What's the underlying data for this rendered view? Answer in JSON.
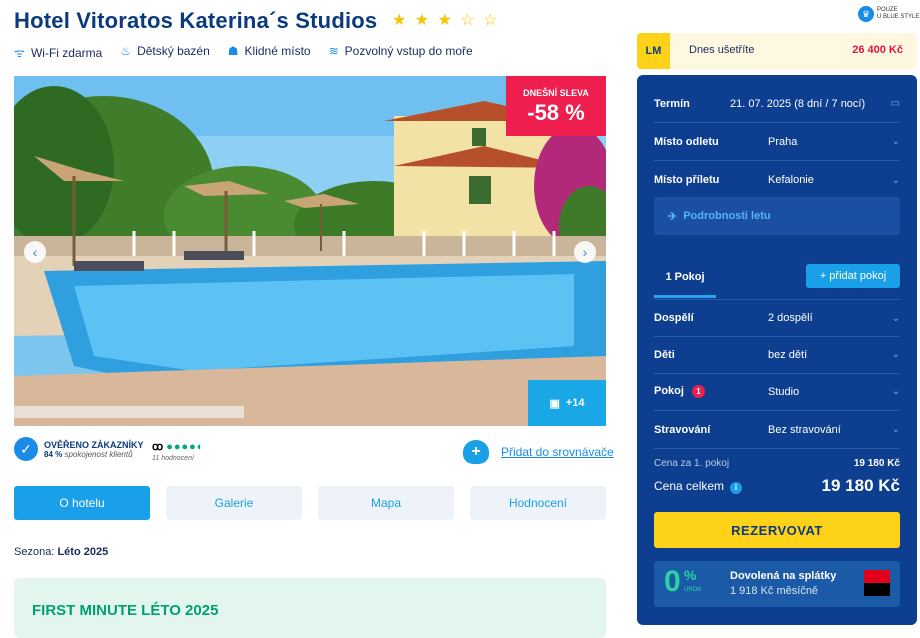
{
  "hotel": {
    "name": "Hotel Vitoratos Katerina´s Studios",
    "stars_filled": "★ ★ ★",
    "stars_empty": "☆ ☆"
  },
  "badge": {
    "line1": "POUZE",
    "line2": "U BLUE STYLE",
    "icon": "crown-icon"
  },
  "amenities": [
    {
      "icon": "wifi-icon",
      "label": "Wi-Fi zdarma"
    },
    {
      "icon": "pool-icon",
      "label": "Dětský bazén"
    },
    {
      "icon": "quiet-icon",
      "label": "Klidné místo"
    },
    {
      "icon": "beach-icon",
      "label": "Pozvolný vstup do moře"
    }
  ],
  "photo": {
    "sale_label": "DNEŠNÍ SLEVA",
    "sale_value": "-58 %",
    "gallery_count": "+14"
  },
  "verified": {
    "title": "OVĚŘENO ZÁKAZNÍKY",
    "percent": "84 %",
    "text": "spokojenost klientů"
  },
  "tripadvisor": {
    "rating": 4.5,
    "dots": "●●●●◐",
    "count": "11 hodnocení"
  },
  "compare": {
    "label": "Přidat do srovnávače"
  },
  "tabs": [
    {
      "label": "O hotelu",
      "active": true
    },
    {
      "label": "Galerie"
    },
    {
      "label": "Mapa"
    },
    {
      "label": "Hodnocení"
    }
  ],
  "season": {
    "label": "Sezona:",
    "value": "Léto 2025"
  },
  "first_minute": "FIRST MINUTE LÉTO 2025",
  "lastminute": {
    "badge": "LM",
    "label": "Dnes ušetříte",
    "value": "26 400 Kč"
  },
  "booking": {
    "term_label": "Termín",
    "term_value": "21. 07. 2025 (8 dní / 7 nocí)",
    "departure_label": "Místo odletu",
    "departure_value": "Praha",
    "arrival_label": "Místo příletu",
    "arrival_value": "Kefalonie",
    "flight_details": "Podrobnosti letu",
    "room_tab": "1 Pokoj",
    "add_room": "+ přidat pokoj",
    "adults_label": "Dospělí",
    "adults_value": "2 dospělí",
    "children_label": "Děti",
    "children_value": "bez dětí",
    "room_label": "Pokoj",
    "room_badge": "1",
    "room_value": "Studio",
    "board_label": "Stravování",
    "board_value": "Bez stravování",
    "price_per_room_label": "Cena za 1. pokoj",
    "price_per_room": "19 180 Kč",
    "total_label": "Cena celkem",
    "total": "19 180 Kč",
    "reserve": "REZERVOVAT",
    "loan_zero": "0",
    "loan_pct": "%",
    "loan_small": "ÚROK",
    "loan_title": "Dovolená na splátky",
    "loan_monthly": "1 918 Kč měsíčně"
  }
}
